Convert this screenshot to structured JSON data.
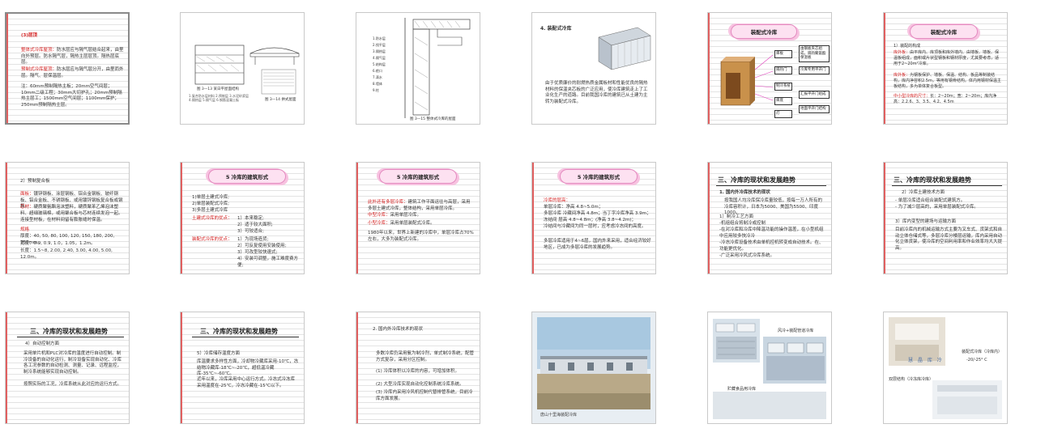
{
  "slides": [
    {
      "heading": "(3)层顶",
      "p1a": "整体式冷库屋顶：",
      "p1b": "防水层应与隔气层结合起来，由里向外预层。防水隔气层，隔热主层层顶。隔热层底层。",
      "p2a": "预制式冷库屋顶：",
      "p2b": "防水层应与隔气层分开，由里而外层。隔气、层保温层。",
      "p3": "注：60mm预制隔热主板；20mm空气间层；10mm二级工程；30mm大切护孔；20mm预制隔热主层工；1500mm空气间层；1100mm保护；250mm预制隔热主层。"
    },
    {
      "cap1": "图 3—13  某日平屋面结构",
      "cap1b": "1.复合防水层材料  2.预制层  3.水泥砂浆层  4.隔热层  5.隔气层  6.钢筋混凝土板",
      "cap2": "图 3—14  拱式屋面"
    },
    {
      "cap": "图 3—15  整体式冷库的屋面",
      "legend": [
        "1.防水层",
        "2.找平层",
        "3.隔热层",
        "4.隔气层",
        "5.结构层",
        "6.檐口",
        "7.滴水",
        "8.墙体",
        "9.柱"
      ]
    },
    {
      "heading": "4.    装配式冷库",
      "body": "由于优质廉价的耐燃热质金属板材和性能优良的隔热材料的保温夹芯板的广泛应用，使冷库建筑走上了工业化生产的道路。目前我国冷库的建筑已从土建为主转为装配式冷库。"
    },
    {
      "cloud": "装配式冷库",
      "boxes": [
        "库板",
        "隔热门",
        "制冷系统",
        "库底",
        "灯"
      ],
      "notes": [
        "由钢板夹芯组成，隔热聚氨酯保温板",
        "冷库专用平开门",
        "汇报平开门组成",
        "地面平开门结构"
      ]
    },
    {
      "cloud": "装配式冷库",
      "h": "1）装配的构成",
      "l1a": "库外板：",
      "l1b": "由平库内、库顶板和库外墙内、由墙板、墙板、保温板组成，面积或片状型钢板和钢材厚度，尤其要考虑，适用于2~20m²冷库。",
      "l2a": "库外板：",
      "l2b": "为钢板保护、墙板、保温、结构、板品等制装结构，库内净容积2.5m，等用有钢骨结构。体内用钢材保温主板结构，多为单体复合板型。",
      "l3a": "中小型冷库的尺寸：",
      "l3b": "长：2~20m；宽：2~20m；库内净高：2.2.6、3、3.5、4.2、4.5m"
    },
    {
      "h": "2）预制复合板",
      "l1a": "面板：",
      "l1b": "镀锌钢板、涂层钢板、铝合金钢板、玻纤钢板、铝合金板、不锈钢板、或用镀锌钢板复合板或钢板。",
      "l2a": "芯材：",
      "l2b": "硬质聚氨酯泡沫塑料，硬质聚苯乙烯泡沫塑料、超细玻璃棉，或用聚合板与芯材连续发泡一起。",
      "l3": "连接型材板，在材料间留有膨胀缝时保温。",
      "l4": "规格",
      "l5": "厚度：40, 50, 80, 100, 120, 150, 180, 200, 250mm。",
      "l6": "宽度：0.9, 0.9, 1.0，1.05，1.2m。",
      "l7": "长度：1.5~8, 2.00, 2.40, 3.00, 4.00, 5.00, 12.0m。"
    },
    {
      "cloud": "5  冷库的建筑形式",
      "items": [
        "1)单层土建式冷库;",
        "2)单层装配式冷库;",
        "3)多层土建式冷库"
      ],
      "a": "土建式冷库的优点：",
      "a_items": [
        "1）本来稳定;",
        "2）适于较大面积;",
        "3）可较适合;"
      ],
      "b": "装配式冷库的优点：",
      "b_items": [
        "1）为现场造货;",
        "2）可反复使用安装使用;",
        "3）可改型较快速式;",
        "4）安装可调整，施工难度费方便;"
      ]
    },
    {
      "cloud": "5  冷库的建筑形式",
      "l1a": "此外还有多层冷库：",
      "l1b": "建筑工作平面运往与高层，采用多层土建式冷库，整体结构，采用单层冷库。",
      "l2a": "中型冷库：",
      "l2b": "采用单层冷库。",
      "l3a": "小型冷库：",
      "l3b": "采用单层装配式冷库。",
      "l4": "1980年以来，世界上新建的冷库中，单层冷库占70%左右，大多为装配式冷库。"
    },
    {
      "cloud": "5  冷库的建筑形式",
      "h": "冷库的层高：",
      "l1": "单层冷库：净高 4.8~5.0m；",
      "l2": "多层冷库  冷藏间净高 4.8m；当丁字冷库净高 3.9m；",
      "l3": "冻结间   层高 4.8~4.8m；(净高 3.8~4.2m)；",
      "l4": "冷结间与冷藏间为同一层时，应考虑冷冻间的高度。",
      "l5": "多层冷库适用于4~6层，国内外来采用，适合经济较好地区，已成为多层冷库的发展趋势。"
    },
    {
      "title": "三、冷库的现状和发展趋势",
      "h1": "1. 国内外冷库技术的现状",
      "p1": "按我国人均冷库保冷库量较低，按每一万人所有的冷库容积计，日本为5000、美国为5500、印度1000。",
      "h2": "1）制冷工艺方面",
      "b": [
        "-机组组合将制冷或控制",
        "-在对冷库和冷库中降温功能的操作温差，在小型机组中应用较多快冷冷",
        "-冷冻冷库设备技术由单机控机转变成自动技术。在、功能更优化。",
        "-广泛采用冷风式冷库系统。"
      ]
    },
    {
      "title": "三、冷库的现状和发展趋势",
      "h1": "2）冷库土建技术方面",
      "p1": "- 单层冷库适合组合装配式建筑方。\n- 为了减少层高的，采用单层装配式冷库。",
      "h2": "3）库内变型的建场与运输方面",
      "p2": "目前冷库内的机械运输方式主要为叉车式、货架式和自动立体仓储式等，多层冷库分楼层运输，库内采用自动化立体货架，使冷库的空间利用率和作业效率均大大提高。"
    },
    {
      "title": "三、冷库的现状和发展趋势",
      "h": "4）自动控制方面",
      "p": "采用单片机和PLC对冷库的温度进行自动控制。制冷设备的自动化运行，制冷设备实现自动化、冷库各工况参数的自动检测、测量、记录、远程监控，制冷系统能够实现自动控制。",
      "p2": "按照实际的工况，冷库系统从此对应的运行方式。"
    },
    {
      "title": "三、冷库的现状和发展趋势",
      "h": "5）冷库储存温度方面",
      "p1": "库温要求多样性方面，冷却物冷藏库采用-10℃，冻结物冷藏库-18℃~-20℃，超低温冷藏库-35℃~-60℃。",
      "p2": "近年以来，冷库采用中心运行方式。冷冻式冷冻库采用温度在-25℃，冷冻冷藏在-15℃以下。"
    },
    {
      "h": "2. 国内外冷库技术的现状",
      "p1": "多数冷库仍采用氨为制冷剂，单式制冷系统，配管方式复杂，采用分区控制。",
      "l1": "(1)  冷库体积以冷库的内容，可增加体积。",
      "l2": "(2)  大型冷库实现自动化控制系统冷库系统。",
      "l3": "(3)  冷库内采用冷风机控制代替排管系统，目前冷库方面发展。"
    },
    {
      "caption": "唐山十里海装配冷库"
    },
    {
      "cap1": "风冷+装配管道冷库",
      "cap2": "贮藏食品用冷库"
    },
    {
      "cap1": "装配式冷库（冷库内）",
      "temp": "-20/-25° C",
      "cap2": "双层结构（冷冻库冷库）",
      "mark": "慧 晶 库 冷"
    }
  ]
}
